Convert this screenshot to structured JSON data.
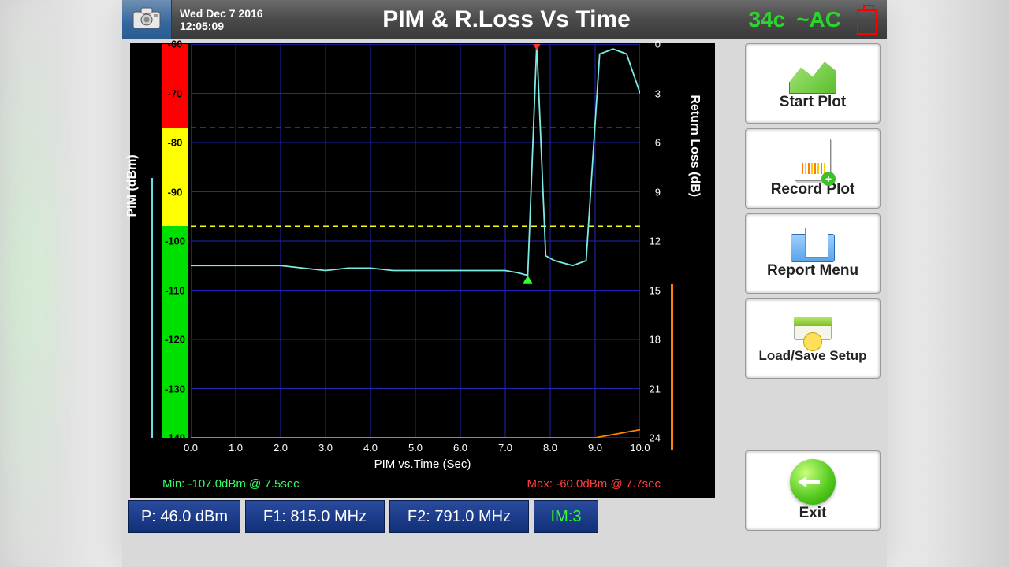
{
  "header": {
    "date": "Wed Dec 7 2016",
    "time": "12:05:09",
    "title": "PIM & R.Loss Vs Time",
    "temp": "34c",
    "power": "~AC"
  },
  "chart_data": {
    "type": "line",
    "xlabel": "PIM vs.Time (Sec)",
    "y_left_label": "PIM (dBm)",
    "y_right_label": "Return Loss (dB)",
    "xlim": [
      0.0,
      10.0
    ],
    "ylim_left": [
      -140,
      -60
    ],
    "ylim_right": [
      24,
      0
    ],
    "x_ticks": [
      "0.0",
      "1.0",
      "2.0",
      "3.0",
      "4.0",
      "5.0",
      "6.0",
      "7.0",
      "8.0",
      "9.0",
      "10.0"
    ],
    "y_left_ticks": [
      -60,
      -70,
      -80,
      -90,
      -100,
      -110,
      -120,
      -130,
      -140
    ],
    "y_right_ticks": [
      0,
      3,
      6,
      9,
      12,
      15,
      18,
      21,
      24
    ],
    "threshold_red": -77,
    "threshold_yellow": -97,
    "series": [
      {
        "name": "PIM",
        "axis": "left",
        "color": "#7debe3",
        "x": [
          0.0,
          0.5,
          1.0,
          1.5,
          2.0,
          2.5,
          3.0,
          3.5,
          4.0,
          4.5,
          5.0,
          5.5,
          6.0,
          6.5,
          7.0,
          7.3,
          7.5,
          7.7,
          7.9,
          8.1,
          8.5,
          8.8,
          9.1,
          9.4,
          9.7,
          10.0
        ],
        "values": [
          -105,
          -105,
          -105,
          -105,
          -105,
          -105.5,
          -106,
          -105.5,
          -105.5,
          -106,
          -106,
          -106,
          -106,
          -106,
          -106,
          -106.5,
          -107,
          -60,
          -103,
          -104,
          -105,
          -104,
          -62,
          -61,
          -62,
          -70
        ]
      },
      {
        "name": "Return Loss",
        "axis": "right",
        "color": "#ff8000",
        "x": [
          0.0,
          5.0,
          9.0,
          9.6,
          10.0
        ],
        "values": [
          24.0,
          24.0,
          24.0,
          23.7,
          23.5
        ]
      }
    ],
    "markers": {
      "min_point": {
        "x": 7.5,
        "value": -107.0,
        "axis": "left",
        "color": "#30ff30",
        "shape": "up"
      },
      "max_point": {
        "x": 7.7,
        "value": -60.0,
        "axis": "left",
        "color": "#ff3030",
        "shape": "down"
      }
    },
    "min_label": "Min: -107.0dBm @ 7.5sec",
    "max_label": "Max: -60.0dBm @ 7.7sec",
    "colorbar_ranges": [
      {
        "from": -60,
        "to": -77,
        "color": "#ff0000"
      },
      {
        "from": -77,
        "to": -97,
        "color": "#ffff00"
      },
      {
        "from": -97,
        "to": -140,
        "color": "#00e000"
      }
    ]
  },
  "bottom": {
    "p": "P: 46.0 dBm",
    "f1": "F1: 815.0 MHz",
    "f2": "F2: 791.0 MHz",
    "im": "IM:3"
  },
  "side": {
    "start": "Start Plot",
    "record": "Record Plot",
    "report": "Report Menu",
    "setup": "Load/Save Setup",
    "exit": "Exit"
  }
}
